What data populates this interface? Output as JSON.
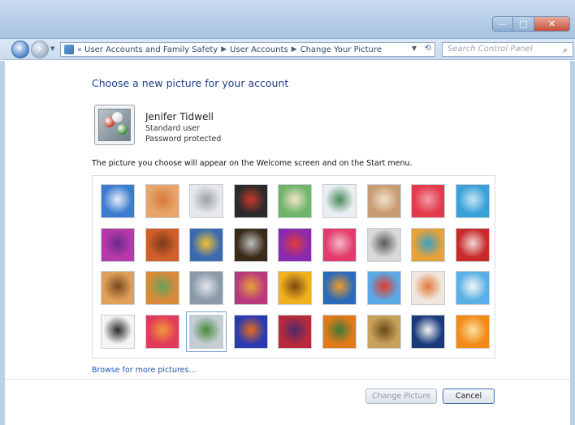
{
  "window": {
    "controls": {
      "min": "—",
      "max": "□",
      "close": "✕"
    }
  },
  "nav": {
    "back_icon": "back-arrow-icon",
    "forward_icon": "forward-arrow-icon",
    "breadcrumb_prefix": "«",
    "breadcrumbs": [
      "User Accounts and Family Safety",
      "User Accounts",
      "Change Your Picture"
    ],
    "search_placeholder": "Search Control Panel"
  },
  "page": {
    "heading": "Choose a new picture for your account",
    "account": {
      "name": "Jenifer Tidwell",
      "type": "Standard user",
      "password_status": "Password protected"
    },
    "description": "The picture you choose will appear on the Welcome screen and on the Start menu.",
    "browse_link": "Browse for more pictures...",
    "buttons": {
      "change_picture": "Change Picture",
      "cancel": "Cancel"
    }
  },
  "pictures": [
    {
      "name": "roller-coaster",
      "colors": [
        "#3b7bd0",
        "#e8eef6"
      ]
    },
    {
      "name": "starfish",
      "colors": [
        "#e7a56a",
        "#d57a3a"
      ]
    },
    {
      "name": "robot-toy",
      "colors": [
        "#e6e8ea",
        "#9aa2aa"
      ]
    },
    {
      "name": "record-player",
      "colors": [
        "#2a2a2a",
        "#c83a2c"
      ]
    },
    {
      "name": "lucky-cat",
      "colors": [
        "#6fb46a",
        "#f3e4c8"
      ]
    },
    {
      "name": "gyroscope",
      "colors": [
        "#e8eef2",
        "#4a8a5a"
      ]
    },
    {
      "name": "kitten",
      "colors": [
        "#c89c72",
        "#f0e2cc"
      ]
    },
    {
      "name": "red-flower",
      "colors": [
        "#e23a4a",
        "#f49aa8"
      ]
    },
    {
      "name": "pinwheel",
      "colors": [
        "#3aa0d8",
        "#c8e6f6"
      ]
    },
    {
      "name": "spinning-top",
      "colors": [
        "#b83aa8",
        "#6a2a8c"
      ]
    },
    {
      "name": "fabric",
      "colors": [
        "#d0602a",
        "#7a3a1a"
      ]
    },
    {
      "name": "leaf",
      "colors": [
        "#3a6ab0",
        "#f0c232"
      ]
    },
    {
      "name": "dog",
      "colors": [
        "#3a2a1a",
        "#c0c0c0"
      ]
    },
    {
      "name": "crayons",
      "colors": [
        "#8a2ab0",
        "#e23a3a"
      ]
    },
    {
      "name": "pink-plant",
      "colors": [
        "#e23a6a",
        "#f4b8c8"
      ]
    },
    {
      "name": "jacks",
      "colors": [
        "#d8d8d8",
        "#5a5a5a"
      ]
    },
    {
      "name": "stairs",
      "colors": [
        "#e6a23a",
        "#3aa0c8"
      ]
    },
    {
      "name": "paper-crane",
      "colors": [
        "#c82a2a",
        "#f0d8d8"
      ]
    },
    {
      "name": "guitar",
      "colors": [
        "#e0a05a",
        "#7a4a20"
      ]
    },
    {
      "name": "puppy",
      "colors": [
        "#d88a3a",
        "#6aa05a"
      ]
    },
    {
      "name": "robot",
      "colors": [
        "#8a9aa8",
        "#e2e6ea"
      ]
    },
    {
      "name": "scarves",
      "colors": [
        "#b83a7a",
        "#e6a23a"
      ]
    },
    {
      "name": "sunflower",
      "colors": [
        "#f0b020",
        "#7a4a10"
      ]
    },
    {
      "name": "fish",
      "colors": [
        "#2a6ab8",
        "#f09a2a"
      ]
    },
    {
      "name": "hot-air-balloon",
      "colors": [
        "#5aa8e6",
        "#e23a2a"
      ]
    },
    {
      "name": "doll",
      "colors": [
        "#f0e8e0",
        "#e27a3a"
      ]
    },
    {
      "name": "sailboat",
      "colors": [
        "#5ab0e6",
        "#f6f6f6"
      ]
    },
    {
      "name": "soccer-ball",
      "colors": [
        "#f4f4f4",
        "#2a2a2a"
      ]
    },
    {
      "name": "tapestry",
      "colors": [
        "#e23a5a",
        "#f09a3a"
      ]
    },
    {
      "name": "marbles",
      "colors": [
        "#c4ccd4",
        "#4a8a3a"
      ]
    },
    {
      "name": "window",
      "colors": [
        "#2a3ab0",
        "#e86a1a"
      ]
    },
    {
      "name": "textile",
      "colors": [
        "#b82a3a",
        "#4a2a6a"
      ]
    },
    {
      "name": "butterfly",
      "colors": [
        "#e27a1a",
        "#3a7a3a"
      ]
    },
    {
      "name": "shell",
      "colors": [
        "#c8a25a",
        "#6a4a1a"
      ]
    },
    {
      "name": "lighthouse",
      "colors": [
        "#1a3a7a",
        "#f4f4f4"
      ]
    },
    {
      "name": "orange-flower",
      "colors": [
        "#f28a1a",
        "#fae0a0"
      ]
    }
  ],
  "selected_picture_index": 29
}
